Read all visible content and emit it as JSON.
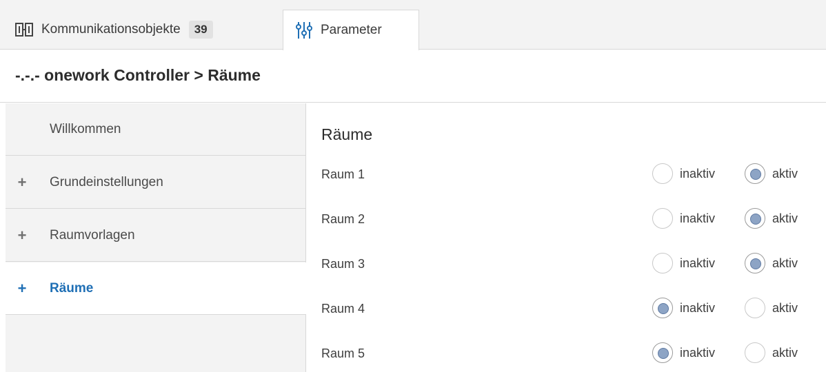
{
  "tabs": {
    "objects_label": "Kommunikationsobjekte",
    "objects_count": "39",
    "parameter_label": "Parameter"
  },
  "breadcrumb": "-.-.- onework Controller > Räume",
  "sidebar": {
    "items": [
      {
        "label": "Willkommen",
        "plus": ""
      },
      {
        "label": "Grundeinstellungen",
        "plus": "+"
      },
      {
        "label": "Raumvorlagen",
        "plus": "+"
      },
      {
        "label": "Räume",
        "plus": "+"
      }
    ]
  },
  "main": {
    "title": "Räume",
    "option_inaktiv": "inaktiv",
    "option_aktiv": "aktiv",
    "rooms": [
      {
        "name": "Raum 1",
        "value": "aktiv"
      },
      {
        "name": "Raum 2",
        "value": "aktiv"
      },
      {
        "name": "Raum 3",
        "value": "aktiv"
      },
      {
        "name": "Raum 4",
        "value": "inaktiv"
      },
      {
        "name": "Raum 5",
        "value": "inaktiv"
      }
    ]
  },
  "colors": {
    "accent": "#1f6fb5",
    "radio_fill": "#8da4c5"
  },
  "icons": {
    "objects_tab": "communication-objects-icon",
    "parameter_tab": "sliders-icon"
  }
}
